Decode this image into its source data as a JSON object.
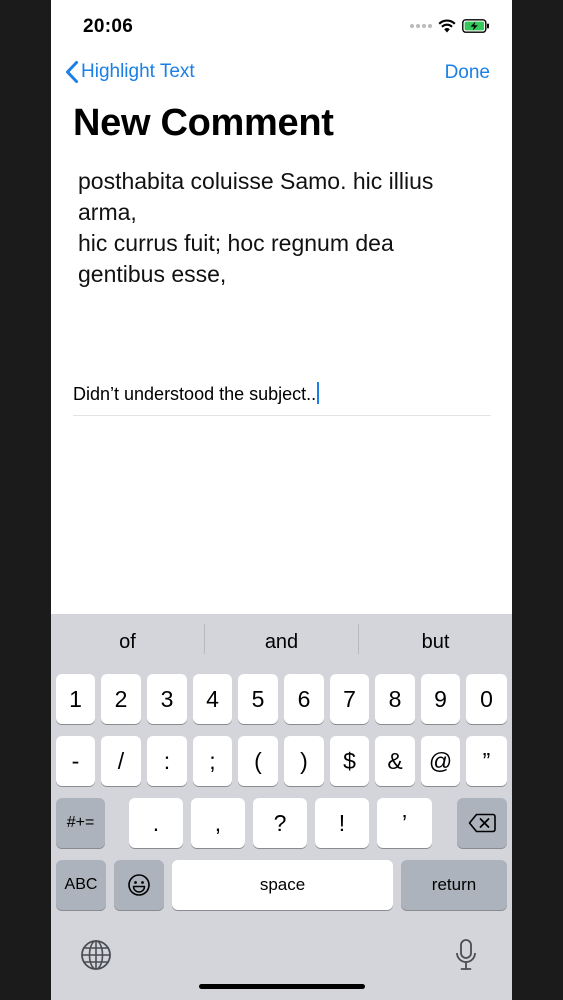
{
  "status": {
    "time": "20:06"
  },
  "nav": {
    "back_label": "Highlight Text",
    "done_label": "Done"
  },
  "page": {
    "title": "New Comment"
  },
  "quote": {
    "lines": [
      "posthabita coluisse Samo. hic illius",
      "arma,",
      "hic currus fuit; hoc regnum dea",
      "gentibus esse,"
    ]
  },
  "comment": {
    "value": "Didn’t understood the subject.."
  },
  "keyboard": {
    "suggestions": [
      "of",
      "and",
      "but"
    ],
    "row1": [
      "1",
      "2",
      "3",
      "4",
      "5",
      "6",
      "7",
      "8",
      "9",
      "0"
    ],
    "row2": [
      "-",
      "/",
      ":",
      ";",
      "(",
      ")",
      "$",
      "&",
      "@",
      "”"
    ],
    "row3_left": "#+=",
    "row3": [
      ".",
      ",",
      "?",
      "!",
      "’"
    ],
    "abc_label": "ABC",
    "space_label": "space",
    "return_label": "return"
  },
  "colors": {
    "accent": "#1a7fe6",
    "keyboard_bg": "#d3d5db",
    "key_dark": "#adb3bd"
  },
  "icons": [
    "wifi-icon",
    "battery-charging-icon",
    "chevron-left-icon",
    "delete-icon",
    "emoji-icon",
    "globe-icon",
    "microphone-icon"
  ]
}
